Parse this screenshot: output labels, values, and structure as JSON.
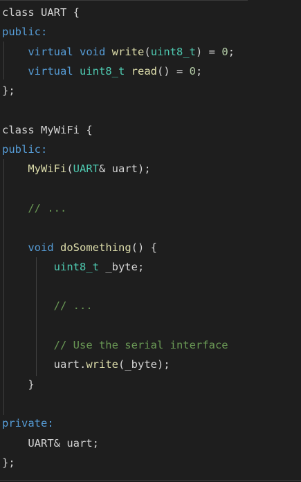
{
  "theme": {
    "background": "#1e1e1e",
    "keyword": "#569cd6",
    "type": "#4ec9b0",
    "function": "#dcdcaa",
    "number": "#b5cea8",
    "comment": "#6a9955",
    "plain": "#d4d4d4"
  },
  "code": {
    "lines": [
      [
        {
          "t": "class UART {",
          "c": "pl"
        }
      ],
      [
        {
          "t": "public:",
          "c": "kw"
        }
      ],
      [
        {
          "t": "    ",
          "c": "pl"
        },
        {
          "t": "virtual",
          "c": "kw"
        },
        {
          "t": " ",
          "c": "pl"
        },
        {
          "t": "void",
          "c": "kw"
        },
        {
          "t": " ",
          "c": "pl"
        },
        {
          "t": "write",
          "c": "fn"
        },
        {
          "t": "(",
          "c": "pl"
        },
        {
          "t": "uint8_t",
          "c": "type"
        },
        {
          "t": ") = ",
          "c": "pl"
        },
        {
          "t": "0",
          "c": "num"
        },
        {
          "t": ";",
          "c": "pl"
        }
      ],
      [
        {
          "t": "    ",
          "c": "pl"
        },
        {
          "t": "virtual",
          "c": "kw"
        },
        {
          "t": " ",
          "c": "pl"
        },
        {
          "t": "uint8_t",
          "c": "type"
        },
        {
          "t": " ",
          "c": "pl"
        },
        {
          "t": "read",
          "c": "fn"
        },
        {
          "t": "() = ",
          "c": "pl"
        },
        {
          "t": "0",
          "c": "num"
        },
        {
          "t": ";",
          "c": "pl"
        }
      ],
      [
        {
          "t": "};",
          "c": "pl"
        }
      ],
      [],
      [
        {
          "t": "class MyWiFi {",
          "c": "pl"
        }
      ],
      [
        {
          "t": "public:",
          "c": "kw"
        }
      ],
      [
        {
          "t": "    ",
          "c": "pl"
        },
        {
          "t": "MyWiFi",
          "c": "fn"
        },
        {
          "t": "(",
          "c": "pl"
        },
        {
          "t": "UART",
          "c": "type"
        },
        {
          "t": "& uart);",
          "c": "pl"
        }
      ],
      [],
      [
        {
          "t": "    ",
          "c": "pl"
        },
        {
          "t": "// ...",
          "c": "cm"
        }
      ],
      [],
      [
        {
          "t": "    ",
          "c": "pl"
        },
        {
          "t": "void",
          "c": "kw"
        },
        {
          "t": " ",
          "c": "pl"
        },
        {
          "t": "doSomething",
          "c": "fn"
        },
        {
          "t": "() {",
          "c": "pl"
        }
      ],
      [
        {
          "t": "        ",
          "c": "pl"
        },
        {
          "t": "uint8_t",
          "c": "type"
        },
        {
          "t": " _byte;",
          "c": "pl"
        }
      ],
      [],
      [
        {
          "t": "        ",
          "c": "pl"
        },
        {
          "t": "// ...",
          "c": "cm"
        }
      ],
      [],
      [
        {
          "t": "        ",
          "c": "pl"
        },
        {
          "t": "// Use the serial interface",
          "c": "cm"
        }
      ],
      [
        {
          "t": "        uart.",
          "c": "pl"
        },
        {
          "t": "write",
          "c": "fn"
        },
        {
          "t": "(_byte);",
          "c": "pl"
        }
      ],
      [
        {
          "t": "    }",
          "c": "pl"
        }
      ],
      [],
      [
        {
          "t": "private:",
          "c": "kw"
        }
      ],
      [
        {
          "t": "    UART& uart;",
          "c": "pl"
        }
      ],
      [
        {
          "t": "};",
          "c": "pl"
        }
      ]
    ]
  }
}
